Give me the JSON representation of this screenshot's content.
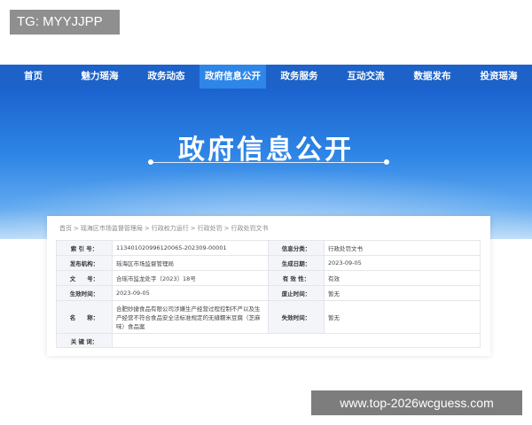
{
  "overlay": {
    "tg_label": "TG: MYYJJPP",
    "watermark_url": "www.top-2026wcguess.com"
  },
  "nav": {
    "items": [
      {
        "label": "首页"
      },
      {
        "label": "魅力瑶海"
      },
      {
        "label": "政务动态"
      },
      {
        "label": "政府信息公开"
      },
      {
        "label": "政务服务"
      },
      {
        "label": "互动交流"
      },
      {
        "label": "数据发布"
      },
      {
        "label": "投资瑶海"
      }
    ],
    "active_index": 3
  },
  "banner": {
    "title": "政府信息公开"
  },
  "breadcrumb": [
    "首页",
    "瑶海区市场监督管理局",
    "行政权力运行",
    "行政处罚",
    "行政处罚文书"
  ],
  "info": {
    "index_no": {
      "label": "索 引 号：",
      "value": "113401020996120065-202309-00001"
    },
    "category": {
      "label": "信息分类：",
      "value": "行政处罚文书"
    },
    "publisher": {
      "label": "发布机构：",
      "value": "瑶海区市场监督管理局"
    },
    "created_date": {
      "label": "生成日期：",
      "value": "2023-09-05"
    },
    "doc_no": {
      "label": "文　　号：",
      "value": "合瑶市监龙处字〔2023〕18号"
    },
    "validity": {
      "label": "有 效 性：",
      "value": "有效"
    },
    "effective_date": {
      "label": "生效时间：",
      "value": "2023-09-05"
    },
    "repeal_date": {
      "label": "废止时间：",
      "value": "暂无"
    },
    "name": {
      "label": "名　　称：",
      "value": "合肥妙捷食品有限公司涉嫌生产经营过程控制不严以及生产经营不符合食品安全法标准规定的无缝糯米豆腐（芝麻味）食品案"
    },
    "invalid_date": {
      "label": "失效时间：",
      "value": "暂无"
    },
    "keywords": {
      "label": "关 键 词：",
      "value": ""
    }
  },
  "colors": {
    "nav_bg": "#1d62c9",
    "nav_active_bg": "#2e86e8",
    "banner_top": "#1b63cf",
    "banner_bottom": "#bcdcf8",
    "label_bg": "#f3f5f9"
  }
}
